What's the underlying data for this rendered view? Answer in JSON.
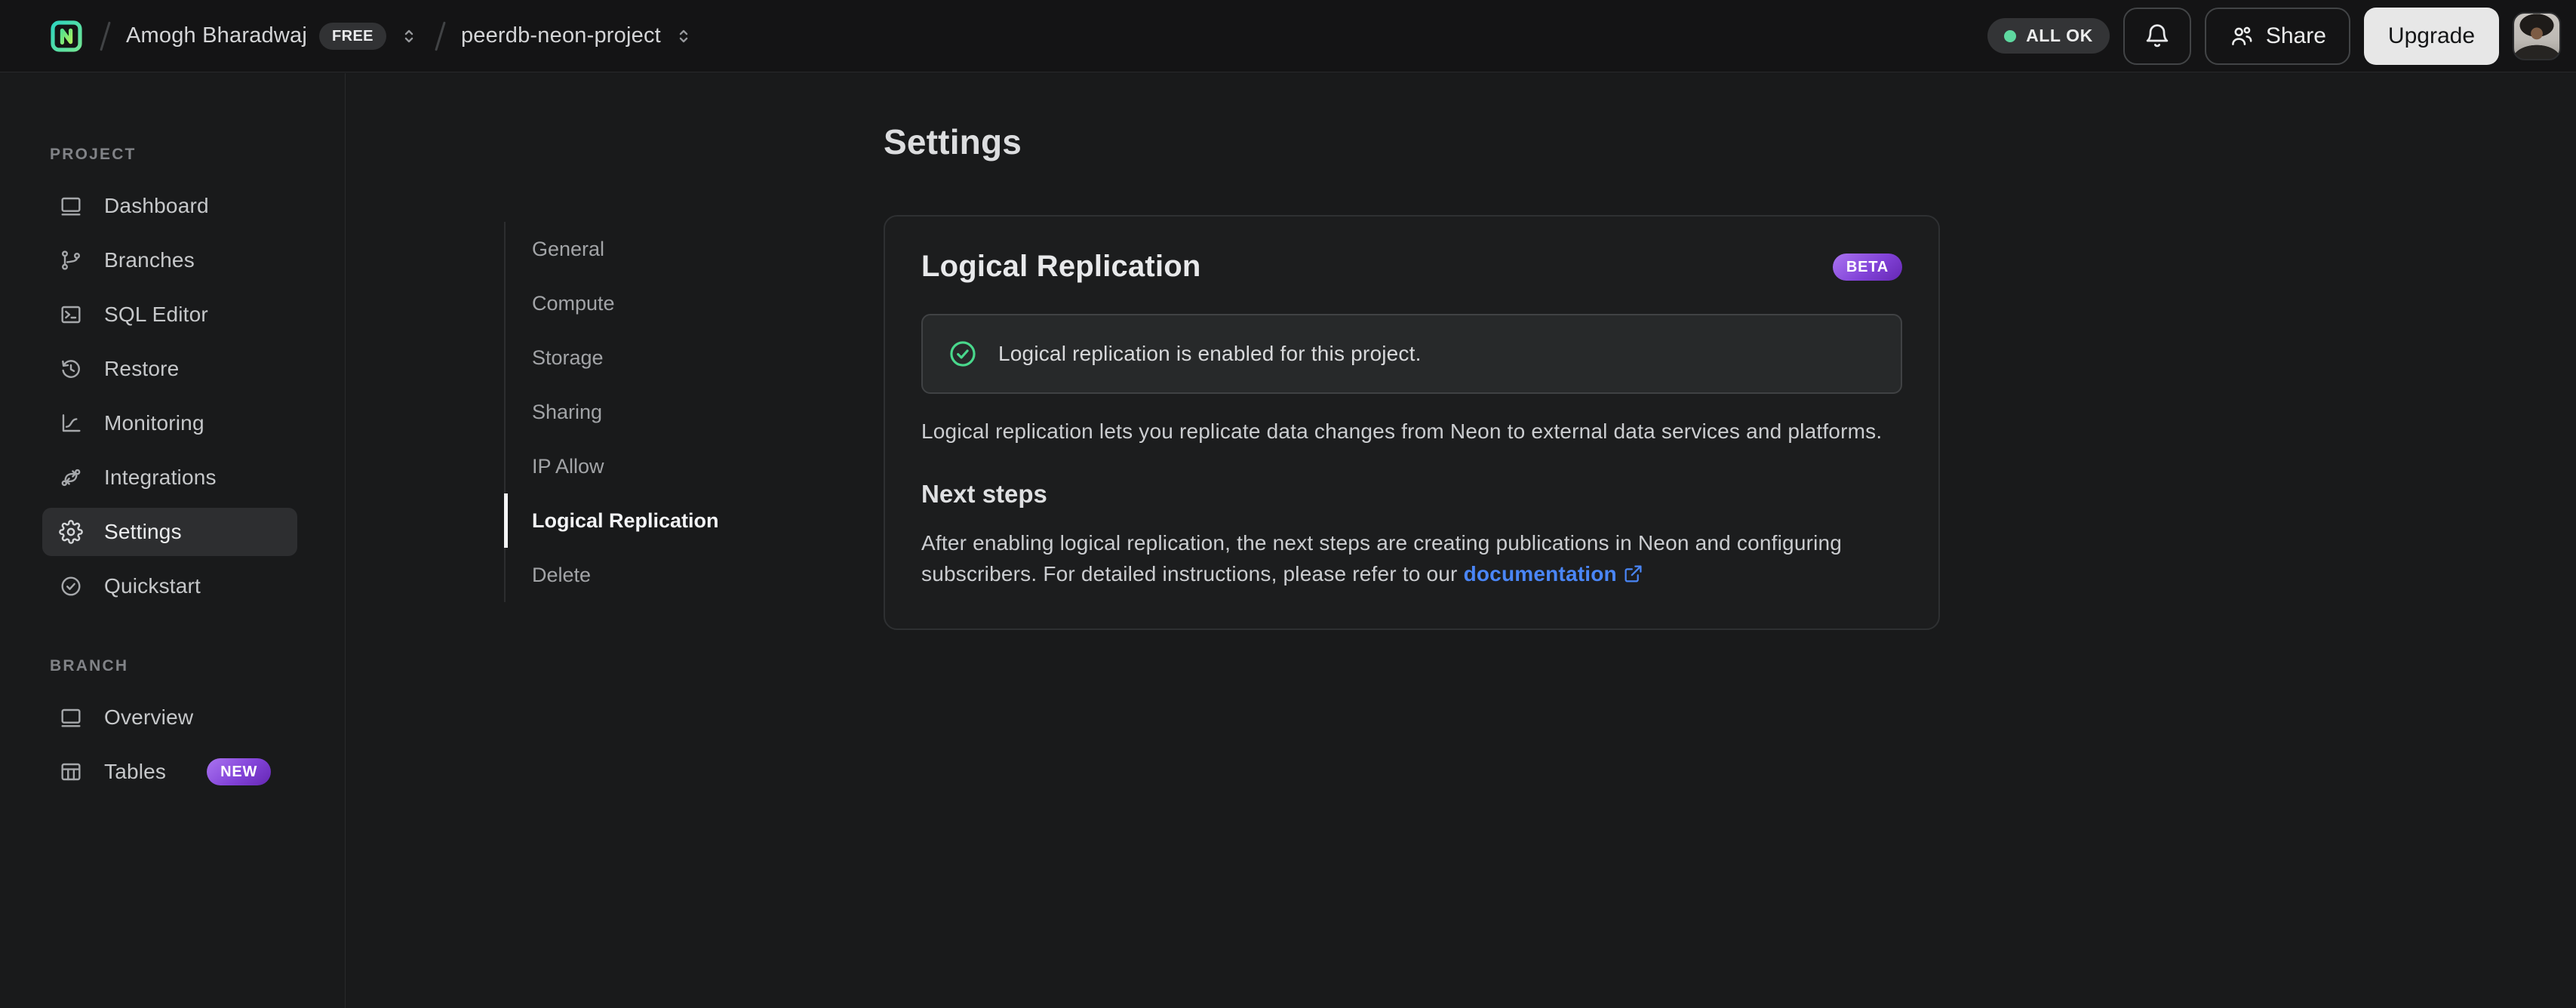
{
  "header": {
    "breadcrumb": {
      "org_name": "Amogh Bharadwaj",
      "org_badge": "FREE",
      "project_name": "peerdb-neon-project"
    },
    "status_label": "ALL OK",
    "share_label": "Share",
    "upgrade_label": "Upgrade"
  },
  "sidebar": {
    "project_section_label": "PROJECT",
    "branch_section_label": "BRANCH",
    "project_items": [
      {
        "label": "Dashboard",
        "icon": "dashboard-icon",
        "active": false
      },
      {
        "label": "Branches",
        "icon": "branches-icon",
        "active": false
      },
      {
        "label": "SQL Editor",
        "icon": "sql-editor-icon",
        "active": false
      },
      {
        "label": "Restore",
        "icon": "restore-icon",
        "active": false
      },
      {
        "label": "Monitoring",
        "icon": "monitoring-icon",
        "active": false
      },
      {
        "label": "Integrations",
        "icon": "integrations-icon",
        "active": false
      },
      {
        "label": "Settings",
        "icon": "gear-icon",
        "active": true
      },
      {
        "label": "Quickstart",
        "icon": "check-circle-icon",
        "active": false
      }
    ],
    "branch_items": [
      {
        "label": "Overview",
        "icon": "overview-icon",
        "active": false
      },
      {
        "label": "Tables",
        "icon": "tables-icon",
        "active": false,
        "badge": "NEW"
      }
    ]
  },
  "settings_nav": {
    "items": [
      {
        "label": "General",
        "active": false
      },
      {
        "label": "Compute",
        "active": false
      },
      {
        "label": "Storage",
        "active": false
      },
      {
        "label": "Sharing",
        "active": false
      },
      {
        "label": "IP Allow",
        "active": false
      },
      {
        "label": "Logical Replication",
        "active": true
      },
      {
        "label": "Delete",
        "active": false
      }
    ]
  },
  "main": {
    "page_title": "Settings",
    "card": {
      "title": "Logical Replication",
      "badge": "BETA",
      "alert_text": "Logical replication is enabled for this project.",
      "description": "Logical replication lets you replicate data changes from Neon to external data services and platforms.",
      "next_steps_title": "Next steps",
      "next_steps_text": "After enabling logical replication, the next steps are creating publications in Neon and configuring subscribers. For detailed instructions, please refer to our ",
      "doc_link_label": "documentation"
    }
  },
  "colors": {
    "page_bg": "#191a1b",
    "header_bg": "#141415",
    "card_bg": "#1c1d1e",
    "alert_bg": "#27292a",
    "success_green": "#49d88c",
    "status_dot_green": "#5ed9a0",
    "badge_purple_start": "#aa74f0",
    "badge_purple_end": "#6527b3",
    "link_blue": "#4a86f7",
    "upgrade_btn_bg": "#e7e7e7"
  }
}
